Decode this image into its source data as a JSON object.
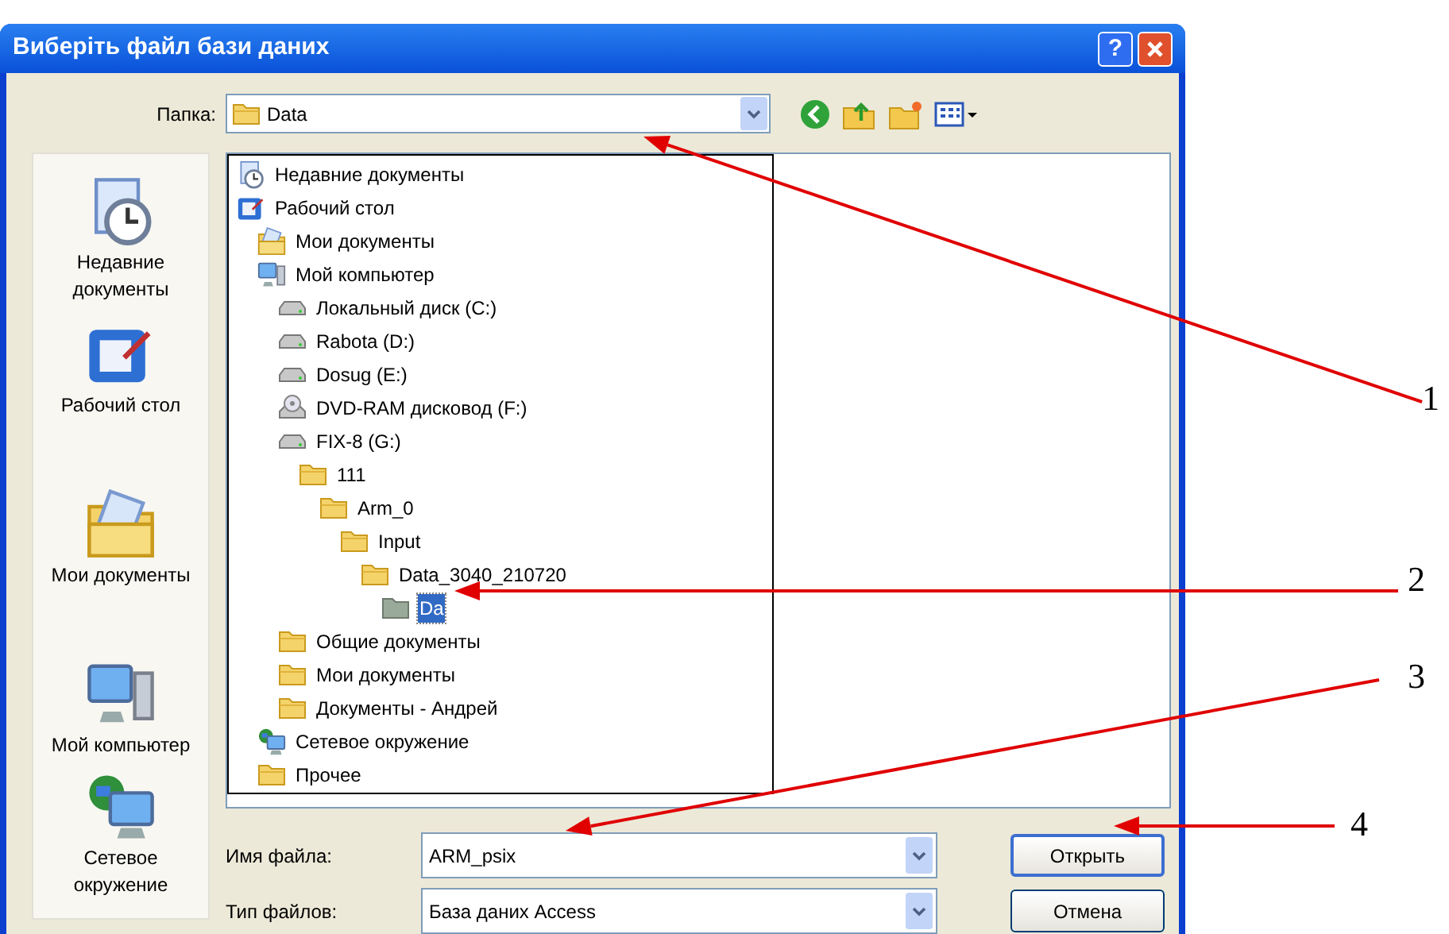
{
  "window": {
    "title": "Виберіть файл бази даних",
    "help_button": "?"
  },
  "folder": {
    "label": "Папка:",
    "value": "Data"
  },
  "folder_tree": [
    {
      "label": "Недавние документы",
      "kind": "recent",
      "selected": false
    },
    {
      "label": "Рабочий стол",
      "kind": "desktop",
      "selected": false,
      "children": [
        {
          "label": "Мои документы",
          "kind": "mydocs",
          "selected": false
        },
        {
          "label": "Мой компьютер",
          "kind": "computer",
          "selected": false,
          "children": [
            {
              "label": "Локальный диск (C:)",
              "kind": "drive",
              "selected": false
            },
            {
              "label": "Rabota (D:)",
              "kind": "drive",
              "selected": false
            },
            {
              "label": "Dosug (E:)",
              "kind": "drive",
              "selected": false
            },
            {
              "label": "DVD-RAM дисковод (F:)",
              "kind": "cdrom",
              "selected": false
            },
            {
              "label": "FIX-8 (G:)",
              "kind": "drive",
              "selected": false,
              "children": [
                {
                  "label": "111",
                  "kind": "folder",
                  "selected": false,
                  "children": [
                    {
                      "label": "Arm_0",
                      "kind": "folder",
                      "selected": false,
                      "children": [
                        {
                          "label": "Input",
                          "kind": "folder",
                          "selected": false,
                          "children": [
                            {
                              "label": "Data_3040_210720",
                              "kind": "folder",
                              "selected": false,
                              "children": [
                                {
                                  "label": "Da",
                                  "kind": "folder",
                                  "selected": true
                                }
                              ]
                            }
                          ]
                        }
                      ]
                    }
                  ]
                }
              ]
            },
            {
              "label": "Общие документы",
              "kind": "folder",
              "selected": false
            },
            {
              "label": "Мои документы",
              "kind": "folder",
              "selected": false
            },
            {
              "label": "Документы - Андрей",
              "kind": "folder",
              "selected": false
            }
          ]
        },
        {
          "label": "Сетевое окружение",
          "kind": "network",
          "selected": false
        },
        {
          "label": "Прочее",
          "kind": "folder",
          "selected": false
        }
      ]
    }
  ],
  "places": [
    {
      "label": "Недавние документы",
      "kind": "recent"
    },
    {
      "label": "Рабочий стол",
      "kind": "desktop"
    },
    {
      "label": "Мои документы",
      "kind": "mydocs"
    },
    {
      "label": "Мой компьютер",
      "kind": "computer"
    },
    {
      "label": "Сетевое окружение",
      "kind": "network"
    }
  ],
  "file_name": {
    "label": "Имя файла:",
    "value": "ARM_psix"
  },
  "file_type": {
    "label": "Тип файлов:",
    "value": "База даних Access"
  },
  "buttons": [
    {
      "label": "Открыть",
      "default": true
    },
    {
      "label": "Отмена",
      "default": false
    }
  ],
  "annotations": [
    {
      "label": "1"
    },
    {
      "label": "2"
    },
    {
      "label": "3"
    },
    {
      "label": "4"
    }
  ]
}
